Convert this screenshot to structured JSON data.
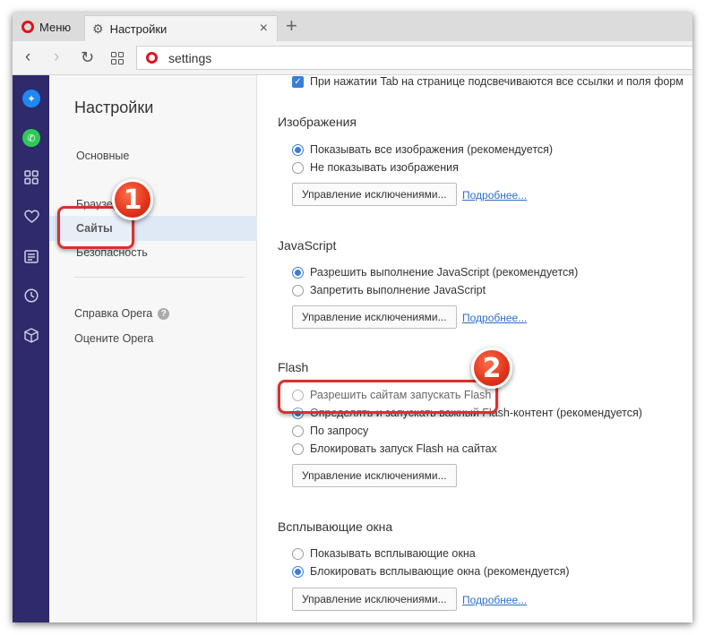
{
  "tabbar": {
    "menu_label": "Меню",
    "tab_title": "Настройки",
    "close_glyph": "×",
    "new_tab_glyph": "+"
  },
  "addressbar": {
    "back_glyph": "‹",
    "forward_glyph": "›",
    "reload_glyph": "↻",
    "url": "settings"
  },
  "sidebar_strip": {
    "icons": [
      "messenger-icon",
      "whatsapp-icon",
      "speed-dial-icon",
      "bookmarks-heart-icon",
      "news-icon",
      "history-clock-icon",
      "extensions-cube-icon"
    ]
  },
  "nav": {
    "title": "Настройки",
    "items": [
      {
        "label": "Основные"
      },
      {
        "label": "Браузер"
      },
      {
        "label": "Сайты",
        "selected": true
      },
      {
        "label": "Безопасность"
      }
    ],
    "links": [
      {
        "label": "Справка Opera"
      },
      {
        "label": "Оцените Opera"
      }
    ]
  },
  "main": {
    "tab_highlight_label": "При нажатии Tab на странице подсвечиваются все ссылки и поля форм",
    "images": {
      "title": "Изображения",
      "options": [
        "Показывать все изображения (рекомендуется)",
        "Не показывать изображения"
      ],
      "selected": 0
    },
    "javascript": {
      "title": "JavaScript",
      "options": [
        "Разрешить выполнение JavaScript (рекомендуется)",
        "Запретить выполнение JavaScript"
      ],
      "selected": 0
    },
    "flash": {
      "title": "Flash",
      "options": [
        "Разрешить сайтам запускать Flash",
        "Определять и запускать важный Flash-контент (рекомендуется)",
        "По запросу",
        "Блокировать запуск Flash на сайтах"
      ],
      "selected": 1
    },
    "popups": {
      "title": "Всплывающие окна",
      "options": [
        "Показывать всплывающие окна",
        "Блокировать всплывающие окна (рекомендуется)"
      ],
      "selected": 1
    },
    "manage_exceptions_label": "Управление исключениями...",
    "more_label": "Подробнее..."
  },
  "callouts": {
    "one": "1",
    "two": "2",
    "color": "#d9312f"
  }
}
